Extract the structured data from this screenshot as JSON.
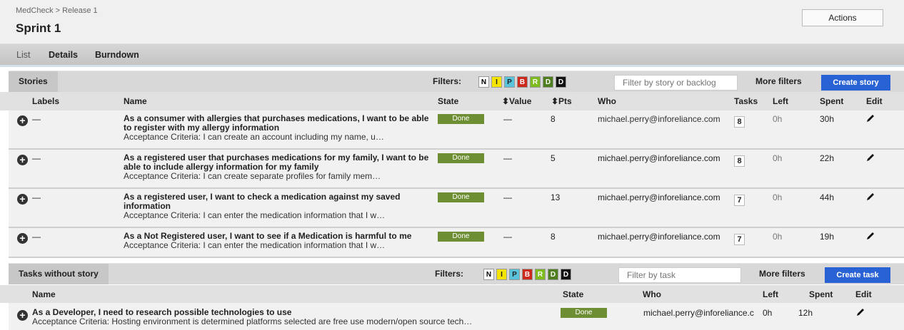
{
  "header": {
    "breadcrumb": "MedCheck > Release 1",
    "title": "Sprint 1",
    "actions_label": "Actions"
  },
  "tabs": [
    {
      "label": "List",
      "active": true
    },
    {
      "label": "Details",
      "active": false
    },
    {
      "label": "Burndown",
      "active": false
    }
  ],
  "stories_bar": {
    "label": "Stories",
    "filters_label": "Filters:",
    "filter_chips": [
      {
        "letter": "N",
        "bg": "#ffffff",
        "fg": "#000000"
      },
      {
        "letter": "I",
        "bg": "#f5e300",
        "fg": "#222222"
      },
      {
        "letter": "P",
        "bg": "#59c3dc",
        "fg": "#222222"
      },
      {
        "letter": "B",
        "bg": "#cc2a1d",
        "fg": "#ffffff"
      },
      {
        "letter": "R",
        "bg": "#7dbb1e",
        "fg": "#ffffff"
      },
      {
        "letter": "D",
        "bg": "#4e7e1d",
        "fg": "#ffffff"
      },
      {
        "letter": "D",
        "bg": "#111111",
        "fg": "#ffffff"
      }
    ],
    "filter_placeholder": "Filter by story or backlog",
    "more_filters": "More filters",
    "create_label": "Create story"
  },
  "stories_columns": {
    "labels": "Labels",
    "name": "Name",
    "state": "State",
    "value": "⬍Value",
    "pts": "⬍Pts",
    "who": "Who",
    "tasks": "Tasks",
    "left": "Left",
    "spent": "Spent",
    "edit": "Edit"
  },
  "stories": [
    {
      "labels": "—",
      "title": "As a consumer with allergies that purchases medications, I want to be able to register with my allergy information",
      "acceptance": "Acceptance Criteria: I can create an account including my name, u…",
      "state": "Done",
      "value": "—",
      "pts": "8",
      "who": "michael.perry@inforeliance.com",
      "tasks": "8",
      "left": "0h",
      "spent": "30h"
    },
    {
      "labels": "—",
      "title": "As a registered user that purchases medications for my family, I want to be able to include allergy information for my family",
      "acceptance": "Acceptance Criteria: I can create separate profiles for family mem…",
      "state": "Done",
      "value": "—",
      "pts": "5",
      "who": "michael.perry@inforeliance.com",
      "tasks": "8",
      "left": "0h",
      "spent": "22h"
    },
    {
      "labels": "—",
      "title": "As a registered user, I want to check a medication against my saved information",
      "acceptance": "Acceptance Criteria: I can enter the medication information that I w…",
      "state": "Done",
      "value": "—",
      "pts": "13",
      "who": "michael.perry@inforeliance.com",
      "tasks": "7",
      "left": "0h",
      "spent": "44h"
    },
    {
      "labels": "—",
      "title": "As a Not Registered user, I want to see if a Medication is harmful to me",
      "acceptance": "Acceptance Criteria: I can enter the medication information that I w…",
      "state": "Done",
      "value": "—",
      "pts": "8",
      "who": "michael.perry@inforeliance.com",
      "tasks": "7",
      "left": "0h",
      "spent": "19h"
    }
  ],
  "tasks_bar": {
    "label": "Tasks without story",
    "filters_label": "Filters:",
    "filter_placeholder": "Filter by task",
    "more_filters": "More filters",
    "create_label": "Create task"
  },
  "tasks_columns": {
    "name": "Name",
    "state": "State",
    "who": "Who",
    "left": "Left",
    "spent": "Spent",
    "edit": "Edit"
  },
  "tasks": [
    {
      "title": "As a Developer, I need to research possible technologies to use",
      "acceptance": "Acceptance Criteria: Hosting environment is determined platforms selected are free use modern/open source tech…",
      "state": "Done",
      "who": "michael.perry@inforeliance.c",
      "left": "0h",
      "spent": "12h"
    }
  ]
}
